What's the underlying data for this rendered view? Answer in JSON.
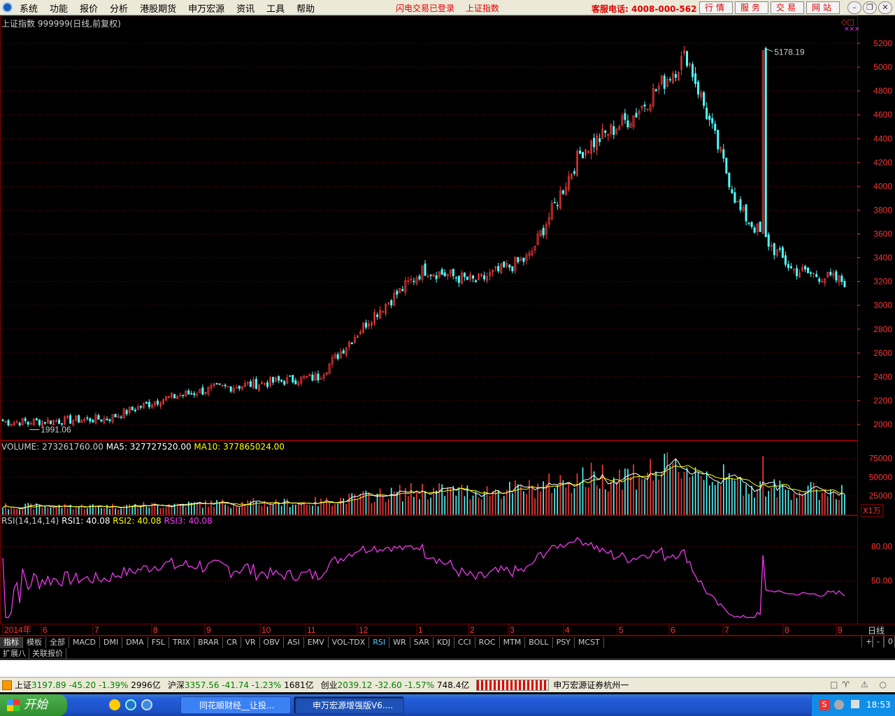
{
  "menubar": {
    "items": [
      "系统",
      "功能",
      "报价",
      "分析",
      "港股期货",
      "申万宏源",
      "资讯",
      "工具",
      "帮助"
    ],
    "status": [
      "闪电交易已登录",
      "上证指数"
    ],
    "hotline": "客服电话: 4008-000-562",
    "buttons": [
      "行情",
      "服务",
      "交易",
      "网站"
    ],
    "window_icons": [
      "minimize-icon",
      "restore-icon",
      "close-icon"
    ]
  },
  "chart": {
    "title": "上证指数 999999(日线,前复权)",
    "volume_header": {
      "label": "VOLUME: 273261760.00",
      "ma5": "MA5: 327727520.00",
      "ma10": "MA10: 377865024.00"
    },
    "rsi_header": {
      "label": "RSI(14,14,14)",
      "rsi1": "RSI1: 40.08",
      "rsi2": "RSI2: 40.08",
      "rsi3": "RSI3: 40.08"
    },
    "high_label": "5178.19",
    "low_label": "1991.06",
    "price_ticks": [
      "5200",
      "5000",
      "4800",
      "4600",
      "4400",
      "4200",
      "4000",
      "3800",
      "3600",
      "3400",
      "3200",
      "3000",
      "2800",
      "2600",
      "2400",
      "2200",
      "2000"
    ],
    "volume_ticks": [
      "75000",
      "50000",
      "25000"
    ],
    "volume_unit": "X1万",
    "rsi_ticks": [
      "80.00",
      "50.00"
    ],
    "date_labels": [
      "2014年",
      "6",
      "7",
      "8",
      "9",
      "10",
      "11",
      "12",
      "1",
      "2",
      "3",
      "4",
      "5",
      "6",
      "7",
      "8",
      "9"
    ],
    "period": "日线",
    "colors": {
      "up": "#ff3c3c",
      "down": "#54ffff",
      "ma5": "#ffffff",
      "ma10": "#ffff00",
      "rsi": "#ff3cff",
      "grid": "#800000"
    }
  },
  "chart_data": {
    "type": "line",
    "title": "上证指数 999999(日线,前复权)",
    "x": [
      "2014-05",
      "2014-06",
      "2014-07",
      "2014-08",
      "2014-09",
      "2014-10",
      "2014-11",
      "2014-12",
      "2015-01",
      "2015-02",
      "2015-03",
      "2015-04",
      "2015-05",
      "2015-06",
      "2015-07",
      "2015-08",
      "2015-09"
    ],
    "series": [
      {
        "values": [
          2020,
          2030,
          2050,
          2210,
          2300,
          2350,
          2400,
          2900,
          3300,
          3200,
          3400,
          4300,
          4600,
          5100,
          3800,
          3300,
          3200
        ]
      }
    ],
    "high": 5178.19,
    "low": 1991.06,
    "ylim": [
      1991.06,
      5178.19
    ]
  },
  "tabs": [
    "指标",
    "模板",
    "全部",
    "MACD",
    "DMI",
    "DMA",
    "FSL",
    "TRIX",
    "BRAR",
    "CR",
    "VR",
    "OBV",
    "ASI",
    "EMV",
    "VOL-TDX",
    "RSI",
    "WR",
    "SAR",
    "KDJ",
    "CCI",
    "ROC",
    "MTM",
    "BOLL",
    "PSY",
    "MCST"
  ],
  "tab_ctrls": [
    "+",
    "-",
    "0"
  ],
  "subtabs": [
    "扩展八",
    "关联报价"
  ],
  "quotes": [
    {
      "name": "上证",
      "value": "3197.89",
      "chg": "-45.20",
      "pct": "-1.39%",
      "amt": "2996亿"
    },
    {
      "name": "沪深",
      "value": "3357.56",
      "chg": "-41.74",
      "pct": "-1.23%",
      "amt": "1681亿"
    },
    {
      "name": "创业",
      "value": "2039.12",
      "chg": "-32.60",
      "pct": "-1.57%",
      "amt": "748.4亿"
    }
  ],
  "broker": "申万宏源证券杭州一",
  "taskbar": {
    "start": "开始",
    "tasks": [
      "同花顺财经__让投...",
      "申万宏源增强版V6...."
    ],
    "clock": "18:53"
  }
}
